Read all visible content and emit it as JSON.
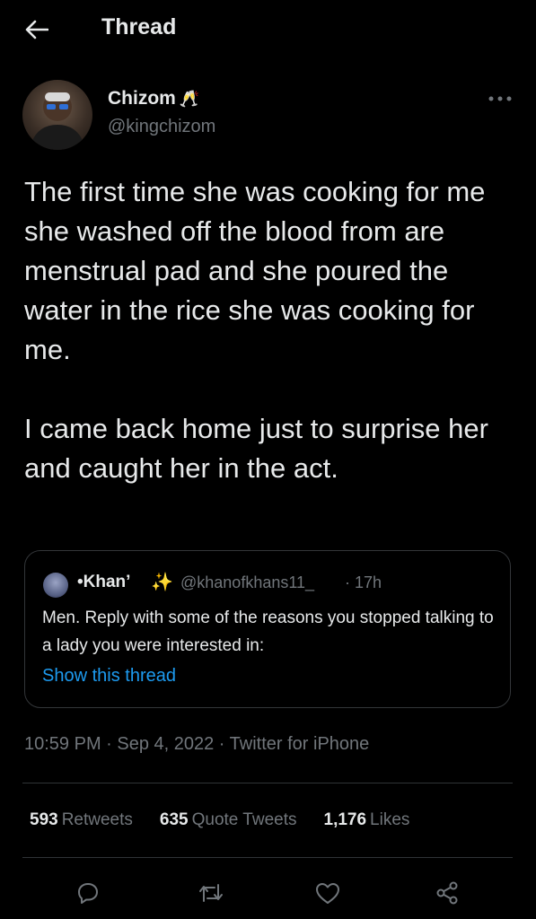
{
  "header": {
    "title": "Thread",
    "back_icon": "arrow-left-icon"
  },
  "tweet": {
    "author_name": "Chizom",
    "author_emoji": "🥂",
    "author_handle": "@kingchizom",
    "more_icon": "more-horizontal-icon",
    "text": "The first time she was cooking for me she washed off the blood from are menstrual pad and she poured the water in the rice she was cooking for me.\n\nI came back home just to surprise her and caught her in the act.",
    "timestamp": "10:59 PM · Sep 4, 2022 · Twitter for iPhone"
  },
  "quoted_tweet": {
    "author_name": "•Khan’",
    "author_emoji": "✨",
    "author_handle": "@khanofkhans11_",
    "time": "· 17h",
    "text": "Men. Reply with some of the reasons you stopped talking to a lady you were interested in:",
    "show_thread_label": "Show this thread"
  },
  "stats": {
    "retweets_count": "593",
    "retweets_label": "Retweets",
    "quotes_count": "635",
    "quotes_label": "Quote Tweets",
    "likes_count": "1,176",
    "likes_label": "Likes"
  },
  "actions": {
    "reply_icon": "reply-icon",
    "retweet_icon": "retweet-icon",
    "like_icon": "heart-icon",
    "share_icon": "share-icon"
  },
  "colors": {
    "background": "#000000",
    "text": "#e7e9ea",
    "secondary": "#71767b",
    "accent": "#1d9bf0",
    "border": "#2f3336"
  }
}
